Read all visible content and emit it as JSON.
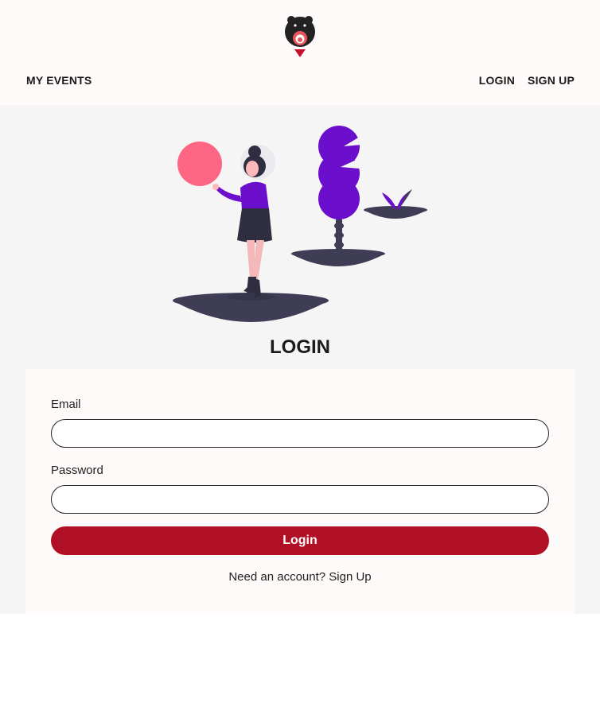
{
  "header": {
    "nav_left": "MY EVENTS",
    "nav_login": "LOGIN",
    "nav_signup": "SIGN UP"
  },
  "login": {
    "title": "LOGIN",
    "email_label": "Email",
    "email_value": "",
    "password_label": "Password",
    "password_value": "",
    "button_label": "Login",
    "prompt_text": "Need an account?",
    "prompt_link": "Sign Up"
  },
  "icons": {
    "logo": "bear-logo-icon",
    "hero": "person-holding-balloon-illustration"
  },
  "colors": {
    "header_bg": "#fffafa",
    "page_bg": "#f5f5f6",
    "button_bg": "#b01025",
    "accent_purple": "#6c0fcc",
    "accent_pink": "#ff6684"
  }
}
